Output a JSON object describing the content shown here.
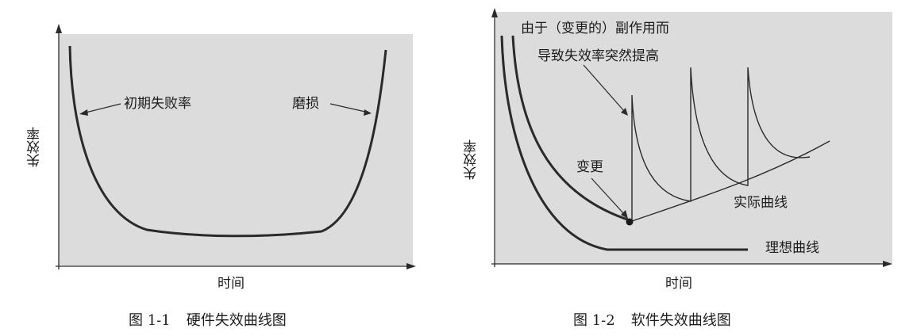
{
  "figure1": {
    "ylabel": "失效率",
    "xlabel": "时间",
    "label_left": "初期失败率",
    "label_right": "磨损",
    "caption_num": "图 1-1",
    "caption_text": "硬件失效曲线图"
  },
  "figure2": {
    "ylabel": "失效率",
    "xlabel": "时间",
    "annotation_line1": "由于（变更的）副作用而",
    "annotation_line2": "导致失效率突然提高",
    "label_change": "变更",
    "label_actual": "实际曲线",
    "label_ideal": "理想曲线",
    "caption_num": "图 1-2",
    "caption_text": "软件失效曲线图"
  },
  "colors": {
    "plot_bg": "#dcdcdc",
    "curve": "#2a2a2a"
  }
}
